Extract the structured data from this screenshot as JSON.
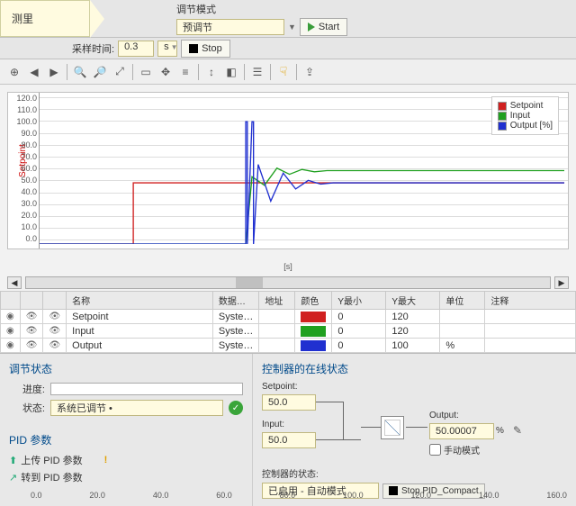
{
  "tabs": {
    "measure": "测里",
    "mode_label": "调节模式",
    "mode_value": "预调节"
  },
  "actions": {
    "start": "Start",
    "stop": "Stop"
  },
  "sample": {
    "label": "采样时间:",
    "value": "0.3",
    "unit": "s"
  },
  "toolbar_icons": [
    "add",
    "back",
    "fwd",
    "sep",
    "zoom-in",
    "zoom-out",
    "fit",
    "sep",
    "rect-select",
    "pan",
    "ruler",
    "sep",
    "cursor",
    "tag",
    "sep",
    "list",
    "sep",
    "hand",
    "sep",
    "export"
  ],
  "chart": {
    "ylabel": "Setpoint",
    "xlabel": "[s]",
    "yticks": [
      "120.0",
      "110.0",
      "100.0",
      "90.0",
      "80.0",
      "70.0",
      "60.0",
      "50.0",
      "40.0",
      "30.0",
      "20.0",
      "10.0",
      "0.0"
    ],
    "xticks": [
      "0.0",
      "20.0",
      "40.0",
      "60.0",
      "80.0",
      "100.0",
      "120.0",
      "140.0",
      "160.0"
    ],
    "legend": [
      {
        "label": "Setpoint",
        "color": "#d02020"
      },
      {
        "label": "Input",
        "color": "#20a020"
      },
      {
        "label": "Output [%]",
        "color": "#2030d0"
      }
    ]
  },
  "chart_data": {
    "type": "line",
    "x_range": [
      0,
      168
    ],
    "y_range": [
      0,
      120
    ],
    "series": [
      {
        "name": "Setpoint",
        "color": "#d02020",
        "points": [
          [
            0,
            0
          ],
          [
            30,
            0
          ],
          [
            30,
            50
          ],
          [
            168,
            50
          ]
        ]
      },
      {
        "name": "Input",
        "color": "#20a020",
        "points": [
          [
            0,
            0
          ],
          [
            66,
            0
          ],
          [
            68,
            55
          ],
          [
            72,
            48
          ],
          [
            76,
            62
          ],
          [
            80,
            57
          ],
          [
            84,
            61
          ],
          [
            88,
            59
          ],
          [
            92,
            60
          ],
          [
            96,
            60
          ],
          [
            168,
            60
          ]
        ]
      },
      {
        "name": "Output [%]",
        "color": "#2030d0",
        "points": [
          [
            0,
            0
          ],
          [
            66,
            0
          ],
          [
            66,
            100
          ],
          [
            66.5,
            100
          ],
          [
            66.5,
            0
          ],
          [
            68,
            100
          ],
          [
            68.5,
            100
          ],
          [
            68.5,
            0
          ],
          [
            70,
            65
          ],
          [
            74,
            35
          ],
          [
            78,
            58
          ],
          [
            82,
            45
          ],
          [
            86,
            52
          ],
          [
            90,
            49
          ],
          [
            94,
            50
          ],
          [
            168,
            50
          ]
        ]
      }
    ]
  },
  "table": {
    "headers": {
      "name": "名称",
      "datatype": "数据…",
      "address": "地址",
      "color": "颜色",
      "ymin": "Y最小",
      "ymax": "Y最大",
      "unit": "单位",
      "comment": "注释"
    },
    "rows": [
      {
        "name": "Setpoint",
        "dt": "Syste…",
        "addr": "",
        "color": "#d02020",
        "ymin": "0",
        "ymax": "120",
        "unit": "",
        "cmt": ""
      },
      {
        "name": "Input",
        "dt": "Syste…",
        "addr": "",
        "color": "#20a020",
        "ymin": "0",
        "ymax": "120",
        "unit": "",
        "cmt": ""
      },
      {
        "name": "Output",
        "dt": "Syste…",
        "addr": "",
        "color": "#2030d0",
        "ymin": "0",
        "ymax": "100",
        "unit": "%",
        "cmt": ""
      }
    ]
  },
  "tuning": {
    "title": "调节状态",
    "progress_lbl": "进度:",
    "status_lbl": "状态:",
    "status_val": "系统已调节 •"
  },
  "pid": {
    "title": "PID 参数",
    "upload": "上传 PID 参数",
    "goto": "转到 PID 参数"
  },
  "online": {
    "title": "控制器的在线状态",
    "setpoint_lbl": "Setpoint:",
    "setpoint_val": "50.0",
    "input_lbl": "Input:",
    "input_val": "50.0",
    "output_lbl": "Output:",
    "output_val": "50.00007",
    "output_unit": "%",
    "manual": "手动模式",
    "ctrl_state_lbl": "控制器的状态:",
    "ctrl_state_val": "已启用 - 自动模式",
    "stop_btn": "Stop PID_Compact"
  }
}
